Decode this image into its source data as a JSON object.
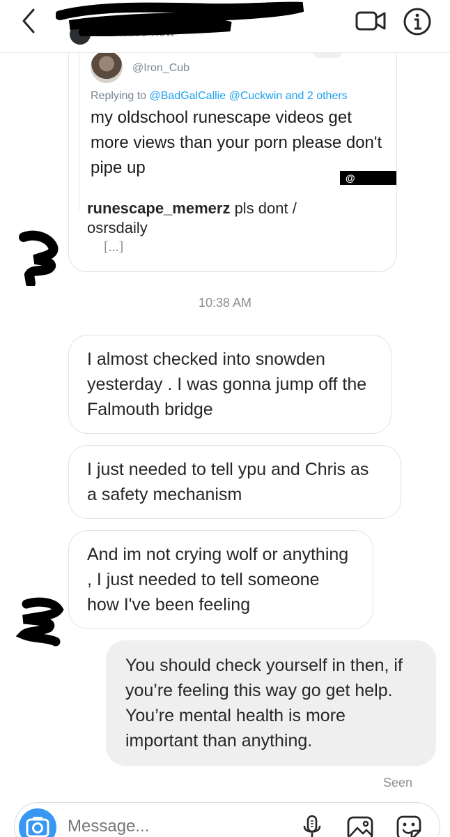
{
  "header": {
    "status": "Active now",
    "back_icon": "chevron-left-icon",
    "video_icon": "video-camera-icon",
    "info_icon": "info-icon"
  },
  "shared_post": {
    "tweet": {
      "handle": "@Iron_Cub",
      "reply_prefix": "Replying to ",
      "reply_mentions": "@BadGalCallie @Cuckwin and 2 others",
      "text": "my oldschool runescape videos get more views than your porn please don't pipe up",
      "watermark": "@ osrsdaily"
    },
    "caption_user": "runescape_memerz",
    "caption_text": " pls dont / osrsdaily",
    "more": "[...]"
  },
  "timestamp": "10:38 AM",
  "messages_incoming": [
    "I almost checked into snowden yesterday . I was gonna jump off the Falmouth bridge",
    "I just needed to tell ypu and Chris as a safety mechanism",
    "And im not crying wolf or anything , I just needed to tell someone how I've been feeling"
  ],
  "message_outgoing": "You should check yourself in then, if you’re feeling this way go get help. You’re mental health is more important than anything.",
  "seen_label": "Seen",
  "composer": {
    "placeholder": "Message...",
    "camera_icon": "camera-icon",
    "mic_icon": "microphone-icon",
    "gallery_icon": "image-gallery-icon",
    "sticker_icon": "sticker-icon"
  },
  "colors": {
    "accent": "#3897f0",
    "online": "#2ec14a",
    "mention": "#1da1f2",
    "outgoing_bubble": "#efefef"
  }
}
